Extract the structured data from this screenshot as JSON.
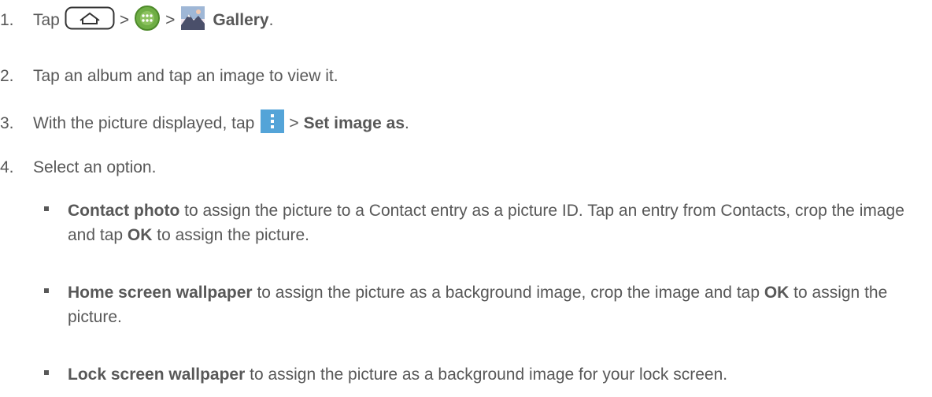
{
  "steps": [
    {
      "num": "1.",
      "tap": "Tap",
      "gt": ">",
      "gallery": "Gallery",
      "end": "."
    },
    {
      "num": "2.",
      "text": "Tap an album and tap an image to view it."
    },
    {
      "num": "3.",
      "pre": "With the picture displayed, tap",
      "gt": ">",
      "bold": "Set image as",
      "end": "."
    },
    {
      "num": "4.",
      "text": "Select an option."
    }
  ],
  "options": [
    {
      "title": "Contact photo",
      "text1": " to assign the picture to a Contact entry as a picture ID. Tap an entry from Contacts, crop the image and tap ",
      "ok": "OK",
      "text2": " to assign the picture."
    },
    {
      "title": "Home screen wallpaper",
      "text1": " to assign the picture as a background image, crop the image and tap ",
      "ok": "OK",
      "text2": " to assign the picture."
    },
    {
      "title": "Lock screen wallpaper",
      "text1": " to assign the picture as a background image for your lock screen."
    }
  ],
  "icons": {
    "home": "home-key-icon",
    "apps": "apps-icon",
    "gallery": "gallery-app-icon",
    "menu": "menu-icon"
  },
  "colors": {
    "text": "#585858",
    "apps_green": "#6fae45",
    "menu_blue": "#54a4d8"
  }
}
